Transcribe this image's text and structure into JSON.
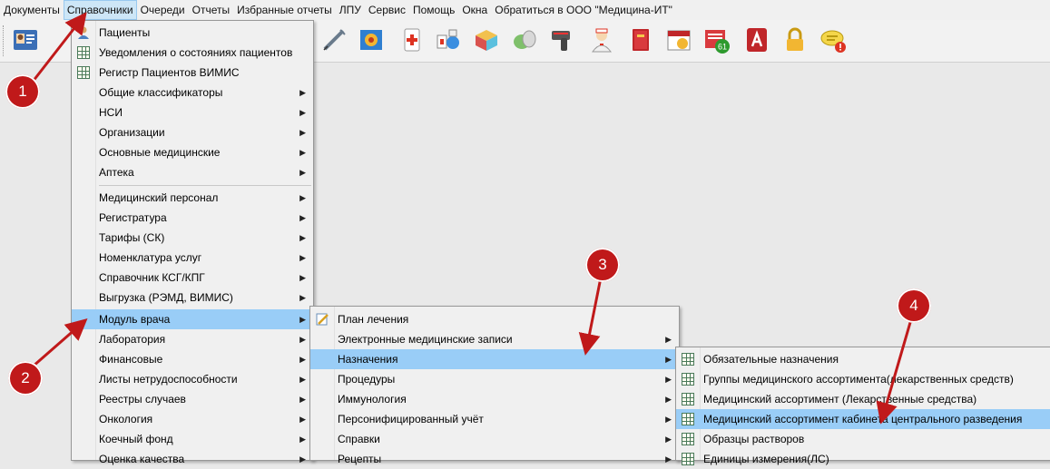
{
  "menubar": {
    "items": [
      "Документы",
      "Справочники",
      "Очереди",
      "Отчеты",
      "Избранные отчеты",
      "ЛПУ",
      "Сервис",
      "Помощь",
      "Окна",
      "Обратиться в ООО \"Медицина-ИТ\""
    ]
  },
  "toolbar": {
    "icons": [
      "patient-card-icon",
      "patient-alt-icon",
      "syringe-icon",
      "schedule-icon",
      "first-aid-icon",
      "lab-icon",
      "package-icon",
      "pills-icon",
      "barcode-scanner-icon",
      "nurse-icon",
      "book-icon",
      "calendar-icon",
      "notifications-icon",
      "pdf-icon",
      "lock-icon",
      "chat-icon"
    ],
    "notification_count": "61"
  },
  "menu1": {
    "items": [
      {
        "label": "Пациенты",
        "submenu": false,
        "icon": "user-icon"
      },
      {
        "label": "Уведомления о состояниях пациентов",
        "submenu": false,
        "icon": "table-icon"
      },
      {
        "label": "Регистр Пациентов ВИМИС",
        "submenu": false,
        "icon": "table-icon"
      },
      {
        "label": "Общие классификаторы",
        "submenu": true
      },
      {
        "label": "НСИ",
        "submenu": true
      },
      {
        "label": "Организации",
        "submenu": true
      },
      {
        "label": "Основные медицинские",
        "submenu": true
      },
      {
        "label": "Аптека",
        "submenu": true
      },
      {
        "label": "Медицинский персонал",
        "submenu": true
      },
      {
        "label": "Регистратура",
        "submenu": true
      },
      {
        "label": "Тарифы (СК)",
        "submenu": true
      },
      {
        "label": "Номенклатура услуг",
        "submenu": true
      },
      {
        "label": "Справочник КСГ/КПГ",
        "submenu": true
      },
      {
        "label": "Выгрузка (РЭМД, ВИМИС)",
        "submenu": true
      },
      {
        "label": "Модуль врача",
        "submenu": true
      },
      {
        "label": "Лаборатория",
        "submenu": true
      },
      {
        "label": "Финансовые",
        "submenu": true
      },
      {
        "label": "Листы нетрудоспособности",
        "submenu": true
      },
      {
        "label": "Реестры случаев",
        "submenu": true
      },
      {
        "label": "Онкология",
        "submenu": true
      },
      {
        "label": "Коечный фонд",
        "submenu": true
      },
      {
        "label": "Оценка качества",
        "submenu": true
      }
    ]
  },
  "menu2": {
    "items": [
      {
        "label": "План лечения",
        "submenu": false,
        "icon": "edit-plan-icon"
      },
      {
        "label": "Электронные медицинские записи",
        "submenu": true
      },
      {
        "label": "Назначения",
        "submenu": true
      },
      {
        "label": "Процедуры",
        "submenu": true
      },
      {
        "label": "Иммунология",
        "submenu": true
      },
      {
        "label": "Персонифицированный учёт",
        "submenu": true
      },
      {
        "label": "Справки",
        "submenu": true
      },
      {
        "label": "Рецепты",
        "submenu": true
      }
    ]
  },
  "menu3": {
    "items": [
      {
        "label": "Обязательные назначения"
      },
      {
        "label": "Группы медицинского ассортимента(лекарственных средств)"
      },
      {
        "label": "Медицинский ассортимент (Лекарственные средства)"
      },
      {
        "label": "Медицинский ассортимент кабинета центрального разведения"
      },
      {
        "label": "Образцы растворов"
      },
      {
        "label": "Единицы измерения(ЛС)"
      }
    ]
  },
  "callouts": [
    "1",
    "2",
    "3",
    "4"
  ],
  "colors": {
    "highlight": "#99cdf7",
    "badge": "#c0191a",
    "arrow": "#c0191a"
  }
}
